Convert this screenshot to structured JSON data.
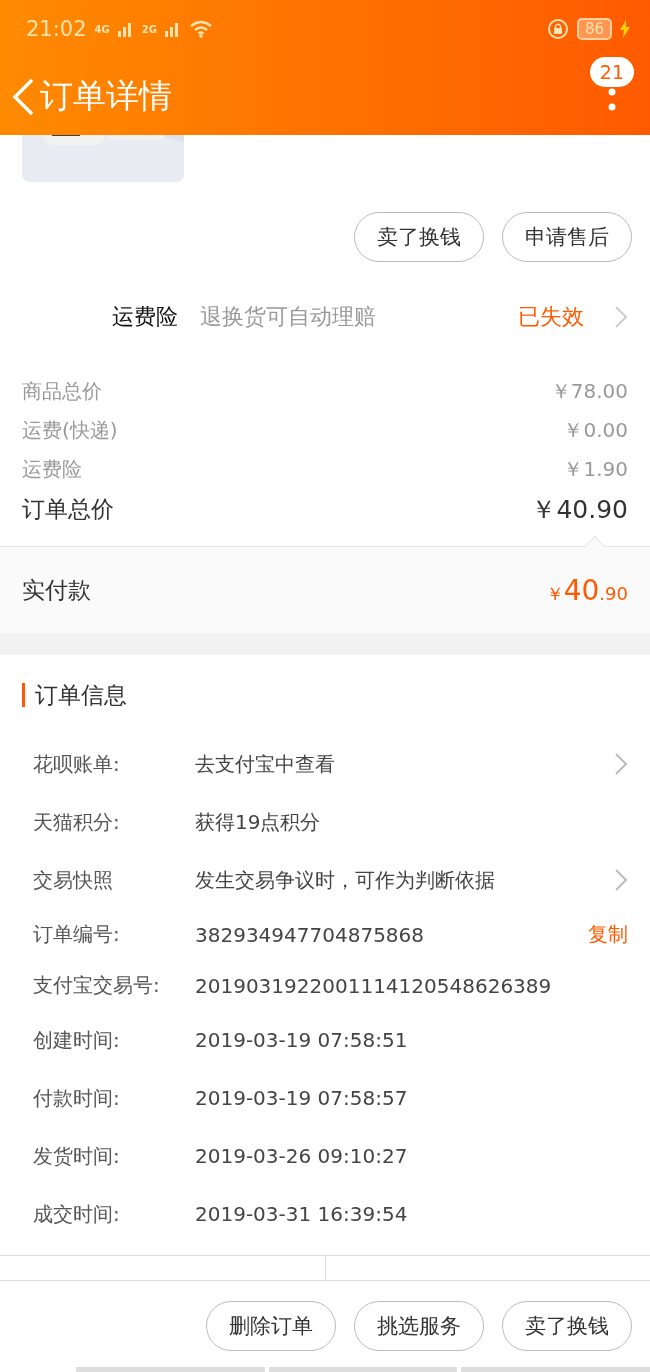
{
  "status_bar": {
    "time": "21:02",
    "network_1": "4G",
    "network_2": "2G",
    "battery": "86"
  },
  "header": {
    "title": "订单详情",
    "badge": "21"
  },
  "product_actions": [
    "卖了换钱",
    "申请售后"
  ],
  "insurance": {
    "title": "运费险",
    "description": "退换货可自动理赔",
    "status": "已失效"
  },
  "prices": [
    {
      "label": "商品总价",
      "value": "￥78.00"
    },
    {
      "label": "运费(快递)",
      "value": "￥0.00"
    },
    {
      "label": "运费险",
      "value": "￥1.90"
    }
  ],
  "total": {
    "label": "订单总价",
    "value": "￥40.90"
  },
  "paid": {
    "label": "实付款",
    "currency": "￥",
    "integer": "40",
    "decimal": ".90"
  },
  "order_info": {
    "title": "订单信息",
    "rows": [
      {
        "label": "花呗账单:",
        "value": "去支付宝中查看",
        "link": true
      },
      {
        "label": "天猫积分:",
        "value": "获得19点积分",
        "link": false
      },
      {
        "label": "交易快照",
        "value": "发生交易争议时，可作为判断依据",
        "link": true
      },
      {
        "label": "订单编号:",
        "value": "382934947704875868",
        "link": false,
        "action": "复制"
      },
      {
        "label": "支付宝交易号:",
        "value": "2019031922001114120548626389",
        "link": false
      },
      {
        "label": "创建时间:",
        "value": "2019-03-19 07:58:51",
        "link": false
      },
      {
        "label": "付款时间:",
        "value": "2019-03-19 07:58:57",
        "link": false
      },
      {
        "label": "发货时间:",
        "value": "2019-03-26 09:10:27",
        "link": false
      },
      {
        "label": "成交时间:",
        "value": "2019-03-31 16:39:54",
        "link": false
      }
    ]
  },
  "bottom_actions": [
    "删除订单",
    "挑选服务",
    "卖了换钱"
  ]
}
